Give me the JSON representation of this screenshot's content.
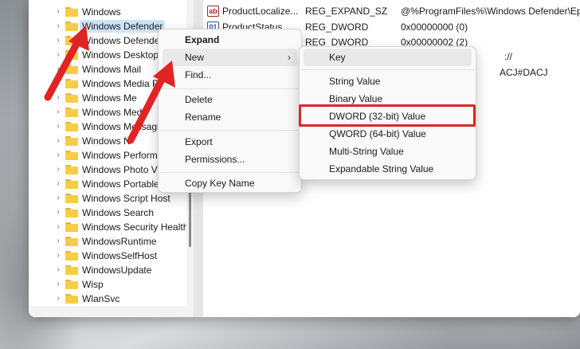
{
  "tree": {
    "items": [
      {
        "label": "Windows"
      },
      {
        "label": "Windows Defender",
        "selected": true
      },
      {
        "label": "Windows Defende"
      },
      {
        "label": "Windows Desktop"
      },
      {
        "label": "Windows Mail"
      },
      {
        "label": "Windows Media P"
      },
      {
        "label": "Windows Me"
      },
      {
        "label": "Windows Med"
      },
      {
        "label": "Windows Messagi"
      },
      {
        "label": "Windows N"
      },
      {
        "label": "Windows Perform"
      },
      {
        "label": "Windows Photo V"
      },
      {
        "label": "Windows Portable"
      },
      {
        "label": "Windows Script Host"
      },
      {
        "label": "Windows Search"
      },
      {
        "label": "Windows Security Health"
      },
      {
        "label": "WindowsRuntime"
      },
      {
        "label": "WindowsSelfHost"
      },
      {
        "label": "WindowsUpdate"
      },
      {
        "label": "Wisp"
      },
      {
        "label": "WlanSvc"
      }
    ]
  },
  "values": {
    "rows": [
      {
        "name": "ProductLocalize...",
        "type": "REG_EXPAND_SZ",
        "data": "@%ProgramFiles%\\Windows Defender\\Ep"
      },
      {
        "name": "ProductStatus",
        "type": "REG_DWORD",
        "data": "0x00000000 (0)"
      },
      {
        "name": "",
        "type": "REG_DWORD",
        "data": "0x00000002 (2)"
      }
    ],
    "fragment_1": "://",
    "fragment_2": "ACJ#DACJ"
  },
  "context_menu": {
    "expand": "Expand",
    "new": "New",
    "find": "Find...",
    "delete": "Delete",
    "rename": "Rename",
    "export": "Export",
    "permissions": "Permissions...",
    "copy_key_name": "Copy Key Name"
  },
  "new_submenu": {
    "key": "Key",
    "string_value": "String Value",
    "binary_value": "Binary Value",
    "dword_value": "DWORD (32-bit) Value",
    "qword_value": "QWORD (64-bit) Value",
    "multi_string_value": "Multi-String Value",
    "expandable_string_value": "Expandable String Value"
  },
  "colors": {
    "highlight": "#d42a2a",
    "annotation_arrow": "#e02424",
    "selection": "#cfe3f7",
    "folder": "#f7cd46"
  }
}
